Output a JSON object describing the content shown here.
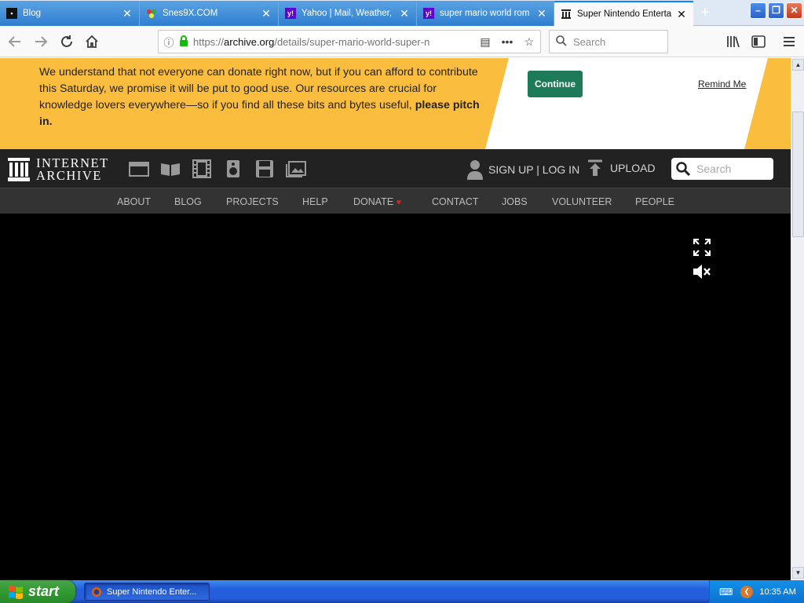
{
  "browser": {
    "tabs": [
      {
        "title": "Blog",
        "icon": "blog-favicon"
      },
      {
        "title": "Snes9X.COM",
        "icon": "snes9x-favicon"
      },
      {
        "title": "Yahoo | Mail, Weather,",
        "icon": "yahoo-favicon"
      },
      {
        "title": "super mario world rom",
        "icon": "yahoo-favicon"
      },
      {
        "title": "Super Nintendo Enterta",
        "icon": "internet-archive-favicon",
        "active": true
      }
    ],
    "url_prefix": "https://",
    "url_domain": "archive.org",
    "url_path": "/details/super-mario-world-super-n",
    "search_placeholder": "Search"
  },
  "donate_banner": {
    "message": "We understand that not everyone can donate right now, but if you can afford to contribute this Saturday, we promise it will be put to good use. Our resources are crucial for knowledge lovers everywhere—so if you find all these bits and bytes useful,",
    "message_bold": "please pitch in.",
    "continue_label": "Continue",
    "remind_label": "Remind Me"
  },
  "ia_header": {
    "logo_line1": "INTERNET",
    "logo_line2": "ARCHIVE",
    "signup_label": "SIGN UP | LOG IN",
    "upload_label": "UPLOAD",
    "search_placeholder": "Search"
  },
  "ia_nav": [
    "ABOUT",
    "BLOG",
    "PROJECTS",
    "HELP",
    "DONATE",
    "CONTACT",
    "JOBS",
    "VOLUNTEER",
    "PEOPLE"
  ],
  "taskbar": {
    "start_label": "start",
    "task_item": "Super Nintendo Enter...",
    "clock": "10:35 AM"
  },
  "colors": {
    "banner_yellow": "#fbbd3d",
    "continue_green": "#1e7b5a",
    "ia_dark": "#222222",
    "active_tab_accent": "#0a84ff"
  }
}
